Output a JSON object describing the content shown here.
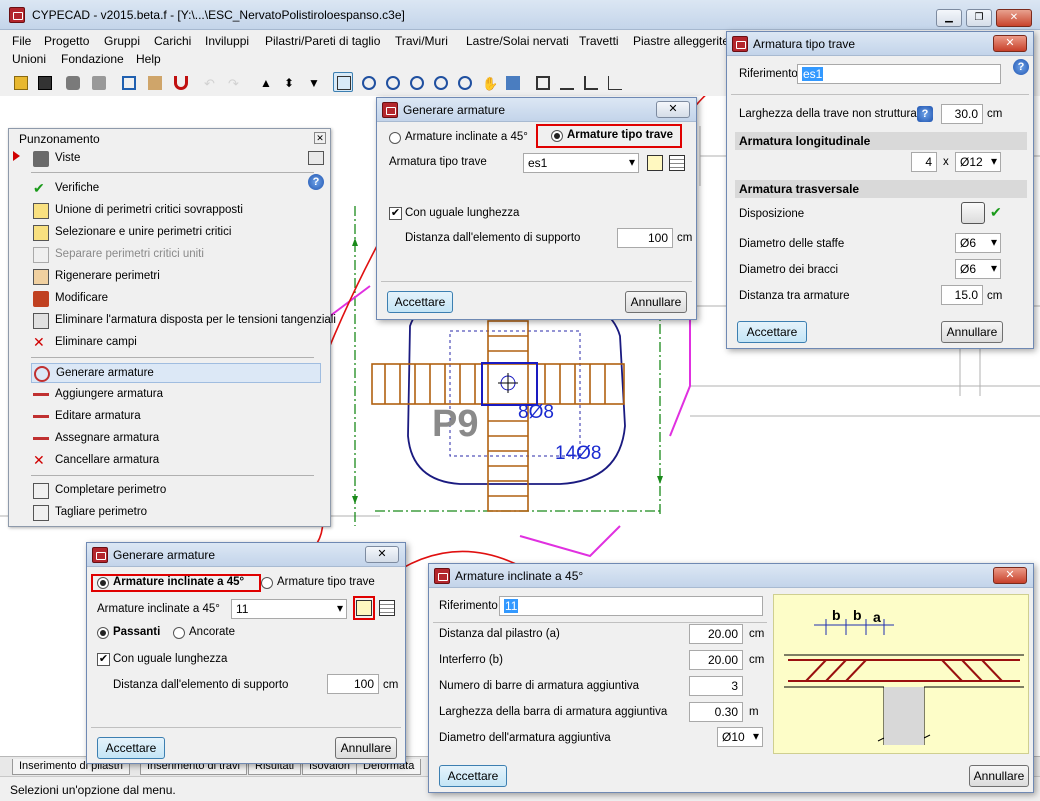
{
  "app": {
    "title": "CYPECAD - v2015.beta.f - [Y:\\...\\ESC_NervatoPolistiroloespanso.c3e]"
  },
  "menu": {
    "row1": [
      "File",
      "Progetto",
      "Gruppi",
      "Carichi",
      "Inviluppi",
      "Pilastri/Pareti di taglio",
      "Travi/Muri",
      "Lastre/Solai nervati",
      "Travetti",
      "Piastre alleggerite"
    ],
    "row2": [
      "Unioni",
      "Fondazione",
      "Help"
    ]
  },
  "side_panel": {
    "title": "Punzonamento",
    "items": [
      {
        "label": "Viste",
        "icon": "view-icon"
      },
      {
        "label": "Verifiche",
        "icon": "check-icon"
      },
      {
        "label": "Unione di perimetri critici sovrapposti",
        "icon": "merge-perimeter-icon"
      },
      {
        "label": "Selezionare e unire perimetri critici",
        "icon": "select-merge-icon"
      },
      {
        "label": "Separare perimetri critici uniti",
        "icon": "separate-icon"
      },
      {
        "label": "Rigenerare perimetri",
        "icon": "regenerate-icon"
      },
      {
        "label": "Modificare",
        "icon": "modify-icon"
      },
      {
        "label": "Eliminare l'armatura disposta per le tensioni tangenziali",
        "icon": "delete-rebar-icon"
      },
      {
        "label": "Eliminare campi",
        "icon": "delete-fields-icon"
      },
      {
        "label": "Generare armature",
        "icon": "generate-rebar-icon"
      },
      {
        "label": "Aggiungere armatura",
        "icon": "add-rebar-icon"
      },
      {
        "label": "Editare armatura",
        "icon": "edit-rebar-icon"
      },
      {
        "label": "Assegnare armatura",
        "icon": "assign-rebar-icon"
      },
      {
        "label": "Cancellare armatura",
        "icon": "cancel-rebar-icon"
      },
      {
        "label": "Completare perimetro",
        "icon": "complete-perimeter-icon"
      },
      {
        "label": "Tagliare perimetro",
        "icon": "cut-perimeter-icon"
      }
    ]
  },
  "drawing": {
    "column_label": "P9",
    "rebar_label_1": "8Ø8",
    "rebar_label_2": "14Ø8"
  },
  "tabs": [
    "Inserimento di pilastri",
    "Inserimento di travi",
    "Risultati",
    "Isovalori",
    "Deformata"
  ],
  "status": "Selezioni un'opzione dal menu.",
  "dlg_gen_top": {
    "title": "Generare armature",
    "radio_inclined": "Armature inclinate a 45°",
    "radio_beam": "Armature tipo trave",
    "combo_label": "Armatura tipo trave",
    "combo_value": "es1",
    "same_length": "Con uguale lunghezza",
    "dist_label": "Distanza dall'elemento di supporto",
    "dist_value": "100",
    "dist_unit": "cm",
    "ok": "Accettare",
    "cancel": "Annullare"
  },
  "dlg_gen_bottom": {
    "title": "Generare armature",
    "radio_inclined": "Armature inclinate a 45°",
    "radio_beam": "Armature tipo trave",
    "combo_label": "Armature inclinate a 45°",
    "combo_value": "11",
    "radio_through": "Passanti",
    "radio_anchored": "Ancorate",
    "same_length": "Con uguale lunghezza",
    "dist_label": "Distanza dall'elemento di supporto",
    "dist_value": "100",
    "dist_unit": "cm",
    "ok": "Accettare",
    "cancel": "Annullare"
  },
  "dlg_beam": {
    "title": "Armatura tipo trave",
    "ref_label": "Riferimento",
    "ref_value": "es1",
    "width_label": "Larghezza della trave non strutturale",
    "width_value": "30.0",
    "width_unit": "cm",
    "section_long": "Armatura longitudinale",
    "long_count": "4",
    "long_x": "x",
    "long_diam": "Ø12",
    "section_trans": "Armatura trasversale",
    "layout_label": "Disposizione",
    "stirrup_label": "Diametro delle staffe",
    "stirrup_value": "Ø6",
    "leg_label": "Diametro dei bracci",
    "leg_value": "Ø6",
    "spacing_label": "Distanza tra armature",
    "spacing_value": "15.0",
    "spacing_unit": "cm",
    "ok": "Accettare",
    "cancel": "Annullare"
  },
  "dlg_incl": {
    "title": "Armature inclinate a 45°",
    "ref_label": "Riferimento",
    "ref_value": "11",
    "fields": [
      {
        "label": "Distanza dal pilastro (a)",
        "value": "20.00",
        "unit": "cm"
      },
      {
        "label": "Interferro (b)",
        "value": "20.00",
        "unit": "cm"
      },
      {
        "label": "Numero di barre di armatura aggiuntiva",
        "value": "3",
        "unit": ""
      },
      {
        "label": "Larghezza della barra di armatura aggiuntiva",
        "value": "0.30",
        "unit": "m"
      }
    ],
    "diam_label": "Diametro dell'armatura aggiuntiva",
    "diam_value": "Ø10",
    "fig_b1": "b",
    "fig_b2": "b",
    "fig_a": "a",
    "ok": "Accettare",
    "cancel": "Annullare"
  }
}
